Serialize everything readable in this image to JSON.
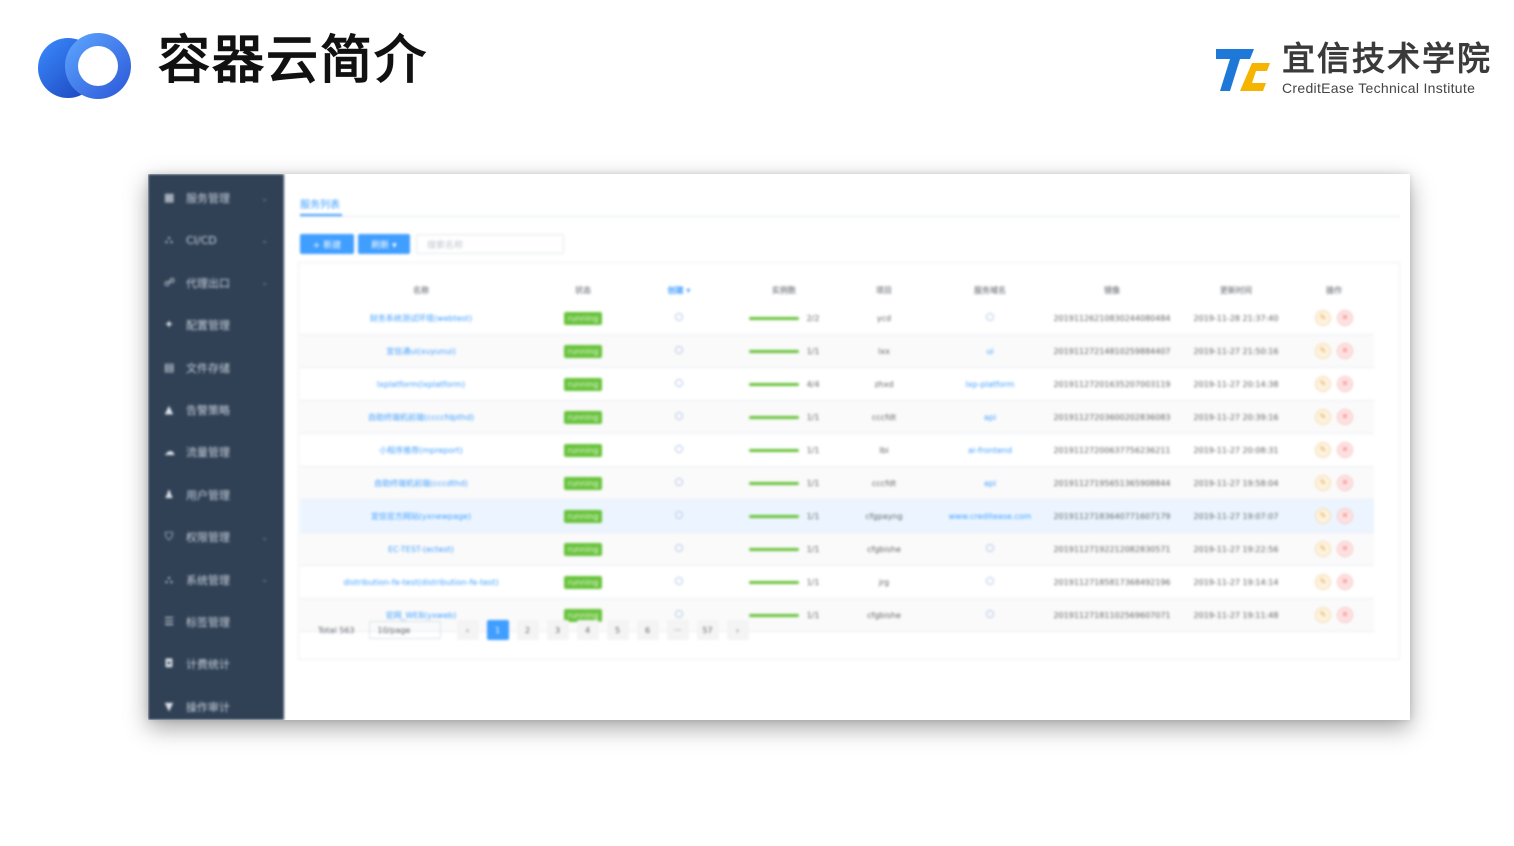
{
  "slide": {
    "title": "容器云简介",
    "brand_cn": "宜信技术学院",
    "brand_en": "CreditEase Technical Institute",
    "colors": {
      "ring_blue": "#2f5fe0",
      "brand_blue": "#1e78d8",
      "brand_yellow": "#f5b400"
    }
  },
  "app": {
    "sidebar": {
      "items": [
        {
          "icon": "grid-icon",
          "label": "服务管理",
          "has_arrow": true
        },
        {
          "icon": "pipeline-icon",
          "label": "CI/CD",
          "has_arrow": true
        },
        {
          "icon": "network-icon",
          "label": "代理出口",
          "has_arrow": true
        },
        {
          "icon": "config-icon",
          "label": "配置管理",
          "has_arrow": false
        },
        {
          "icon": "file-icon",
          "label": "文件存储",
          "has_arrow": false
        },
        {
          "icon": "alert-icon",
          "label": "告警策略",
          "has_arrow": false
        },
        {
          "icon": "cloud-icon",
          "label": "流量管理",
          "has_arrow": false
        },
        {
          "icon": "user-icon",
          "label": "用户管理",
          "has_arrow": false
        },
        {
          "icon": "shield-icon",
          "label": "权限管理",
          "has_arrow": true
        },
        {
          "icon": "system-icon",
          "label": "系统管理",
          "has_arrow": true
        },
        {
          "icon": "list-icon",
          "label": "标签管理",
          "has_arrow": false
        },
        {
          "icon": "billing-icon",
          "label": "计费统计",
          "has_arrow": false
        },
        {
          "icon": "audit-icon",
          "label": "操作审计",
          "has_arrow": false
        }
      ]
    },
    "tab_title": "服务列表",
    "add_button": "+ 新建",
    "refresh_button": "刷新 ▾",
    "search_placeholder": "搜索名称",
    "columns": [
      "名称",
      "状态",
      "创建 ▾",
      "实例数",
      "项目",
      "服务域名",
      "镜像",
      "更新时间",
      "操作"
    ],
    "rows": [
      {
        "name": "财务系统测试环境(webtest)",
        "status": "running",
        "instances": "2/2",
        "instances_frac": 1.0,
        "project": "ycd",
        "domain": "",
        "image": "20191126210830244080484",
        "updated": "2019-11-28 21:37:40"
      },
      {
        "name": "宜信通ui(xuyunui)",
        "status": "running",
        "instances": "1/1",
        "instances_frac": 1.0,
        "project": "lxx",
        "domain": "ui",
        "image": "20191127214810259884407",
        "updated": "2019-11-27 21:50:16"
      },
      {
        "name": "lxplatform(lxplatform)",
        "status": "running",
        "instances": "4/4",
        "instances_frac": 1.0,
        "project": "zhxd",
        "domain": "lxp-platform",
        "image": "20191127201635207003119",
        "updated": "2019-11-27 20:14:38"
      },
      {
        "name": "自助终端机前端(ccccfdpthd)",
        "status": "running",
        "instances": "1/1",
        "instances_frac": 1.0,
        "project": "cccfdt",
        "domain": "api",
        "image": "20191127203600202836083",
        "updated": "2019-11-27 20:39:16"
      },
      {
        "name": "小程序推荐(mpreport)",
        "status": "running",
        "instances": "1/1",
        "instances_frac": 1.0,
        "project": "lbi",
        "domain": "ai-frontend",
        "image": "20191127200637756236211",
        "updated": "2019-11-27 20:08:31"
      },
      {
        "name": "自助终端机前端(cccdthd)",
        "status": "running",
        "instances": "1/1",
        "instances_frac": 1.0,
        "project": "cccfdt",
        "domain": "api",
        "image": "20191127195651365908844",
        "updated": "2019-11-27 19:58:04"
      },
      {
        "name": "宜信官方网站(yxnewpage)",
        "status": "running",
        "instances": "1/1",
        "instances_frac": 1.0,
        "project": "cfgpayng",
        "domain": "www.creditease.com",
        "image": "20191127183640771607179",
        "updated": "2019-11-27 19:07:07"
      },
      {
        "name": "EC-TEST-(ectest)",
        "status": "running",
        "instances": "1/1",
        "instances_frac": 1.0,
        "project": "cfgbishe",
        "domain": "",
        "image": "20191127192212082830571",
        "updated": "2019-11-27 19:22:56"
      },
      {
        "name": "distribution-fe-test(distribution-fe-test)",
        "status": "running",
        "instances": "1/1",
        "instances_frac": 1.0,
        "project": "jrg",
        "domain": "",
        "image": "20191127185817368492196",
        "updated": "2019-11-27 19:14:14"
      },
      {
        "name": "官网_WEB(yxweb)",
        "status": "running",
        "instances": "1/1",
        "instances_frac": 1.0,
        "project": "cfgbishe",
        "domain": "",
        "image": "20191127181102569607071",
        "updated": "2019-11-27 19:11:48"
      }
    ],
    "pagination": {
      "total": "Total 563",
      "page_size": "10/page",
      "prev": "‹",
      "pages": [
        "1",
        "2",
        "3",
        "4",
        "5",
        "6",
        "···",
        "57"
      ],
      "next": "›",
      "active_page": "1"
    }
  }
}
